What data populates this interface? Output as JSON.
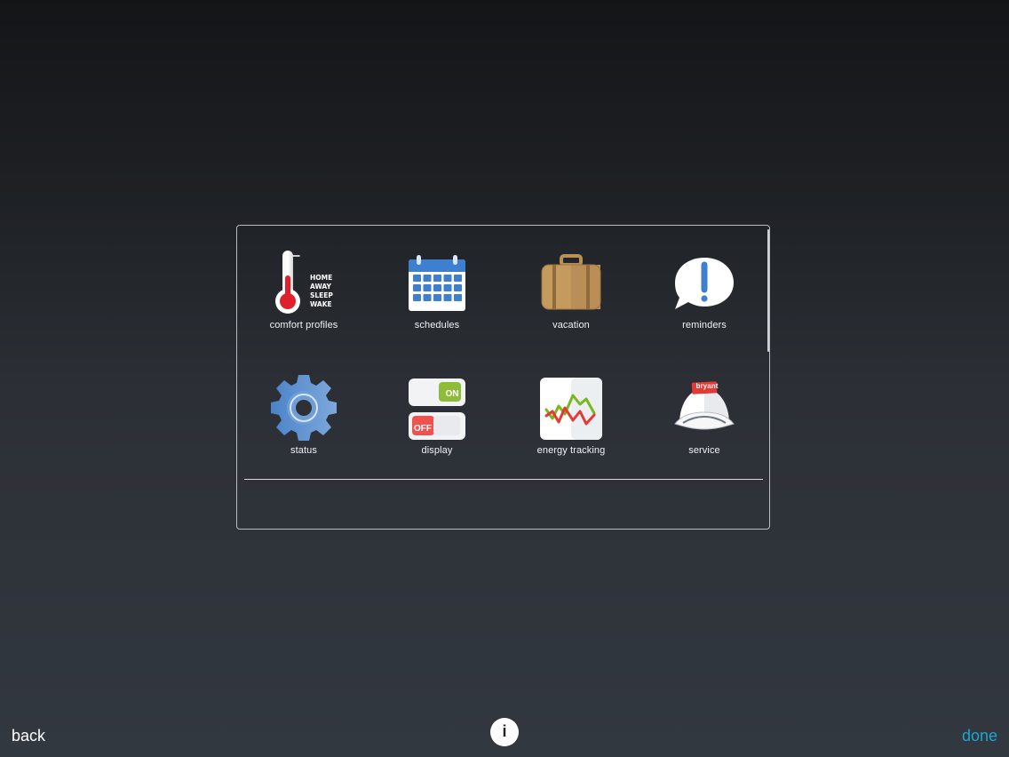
{
  "menu": {
    "items": [
      {
        "label": "comfort profiles",
        "icon": "thermometer-icon",
        "icon_text": [
          "HOME",
          "AWAY",
          "SLEEP",
          "WAKE"
        ]
      },
      {
        "label": "schedules",
        "icon": "calendar-icon"
      },
      {
        "label": "vacation",
        "icon": "suitcase-icon"
      },
      {
        "label": "reminders",
        "icon": "reminder-bubble-icon"
      },
      {
        "label": "status",
        "icon": "gear-icon"
      },
      {
        "label": "display",
        "icon": "toggle-switch-icon",
        "on_text": "ON",
        "off_text": "OFF"
      },
      {
        "label": "energy tracking",
        "icon": "energy-graph-icon"
      },
      {
        "label": "service",
        "icon": "service-cap-icon",
        "brand_text": "bryant"
      }
    ]
  },
  "footer": {
    "back_label": "back",
    "info_label": "i",
    "done_label": "done"
  },
  "colors": {
    "accent": "#1ea6cf",
    "panel_border": "#b9bdc3",
    "background_top": "#141517",
    "background_bottom": "#323840"
  }
}
